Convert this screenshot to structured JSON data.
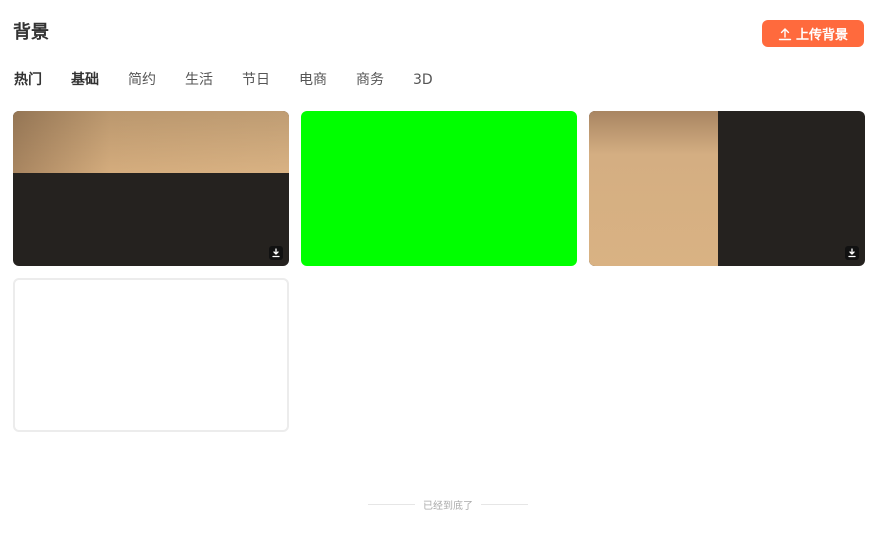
{
  "header": {
    "title": "背景",
    "upload_label": "上传背景"
  },
  "tabs": [
    {
      "label": "热门",
      "active": true
    },
    {
      "label": "基础",
      "active": true
    },
    {
      "label": "简约",
      "active": false
    },
    {
      "label": "生活",
      "active": false
    },
    {
      "label": "节日",
      "active": false
    },
    {
      "label": "电商",
      "active": false
    },
    {
      "label": "商务",
      "active": false
    },
    {
      "label": "3D",
      "active": false
    }
  ],
  "backgrounds": [
    {
      "style": "tan-top-dark-bottom",
      "colors": [
        "#d9b283",
        "#25221f"
      ],
      "downloadable": true
    },
    {
      "style": "solid-green",
      "colors": [
        "#00ff00"
      ],
      "downloadable": false
    },
    {
      "style": "tan-left-dark-right",
      "colors": [
        "#d9b283",
        "#25221f"
      ],
      "downloadable": true
    },
    {
      "style": "solid-white",
      "colors": [
        "#ffffff"
      ],
      "downloadable": false
    }
  ],
  "footer": {
    "end_text": "已经到底了"
  },
  "colors": {
    "accent": "#ff6a3d"
  }
}
